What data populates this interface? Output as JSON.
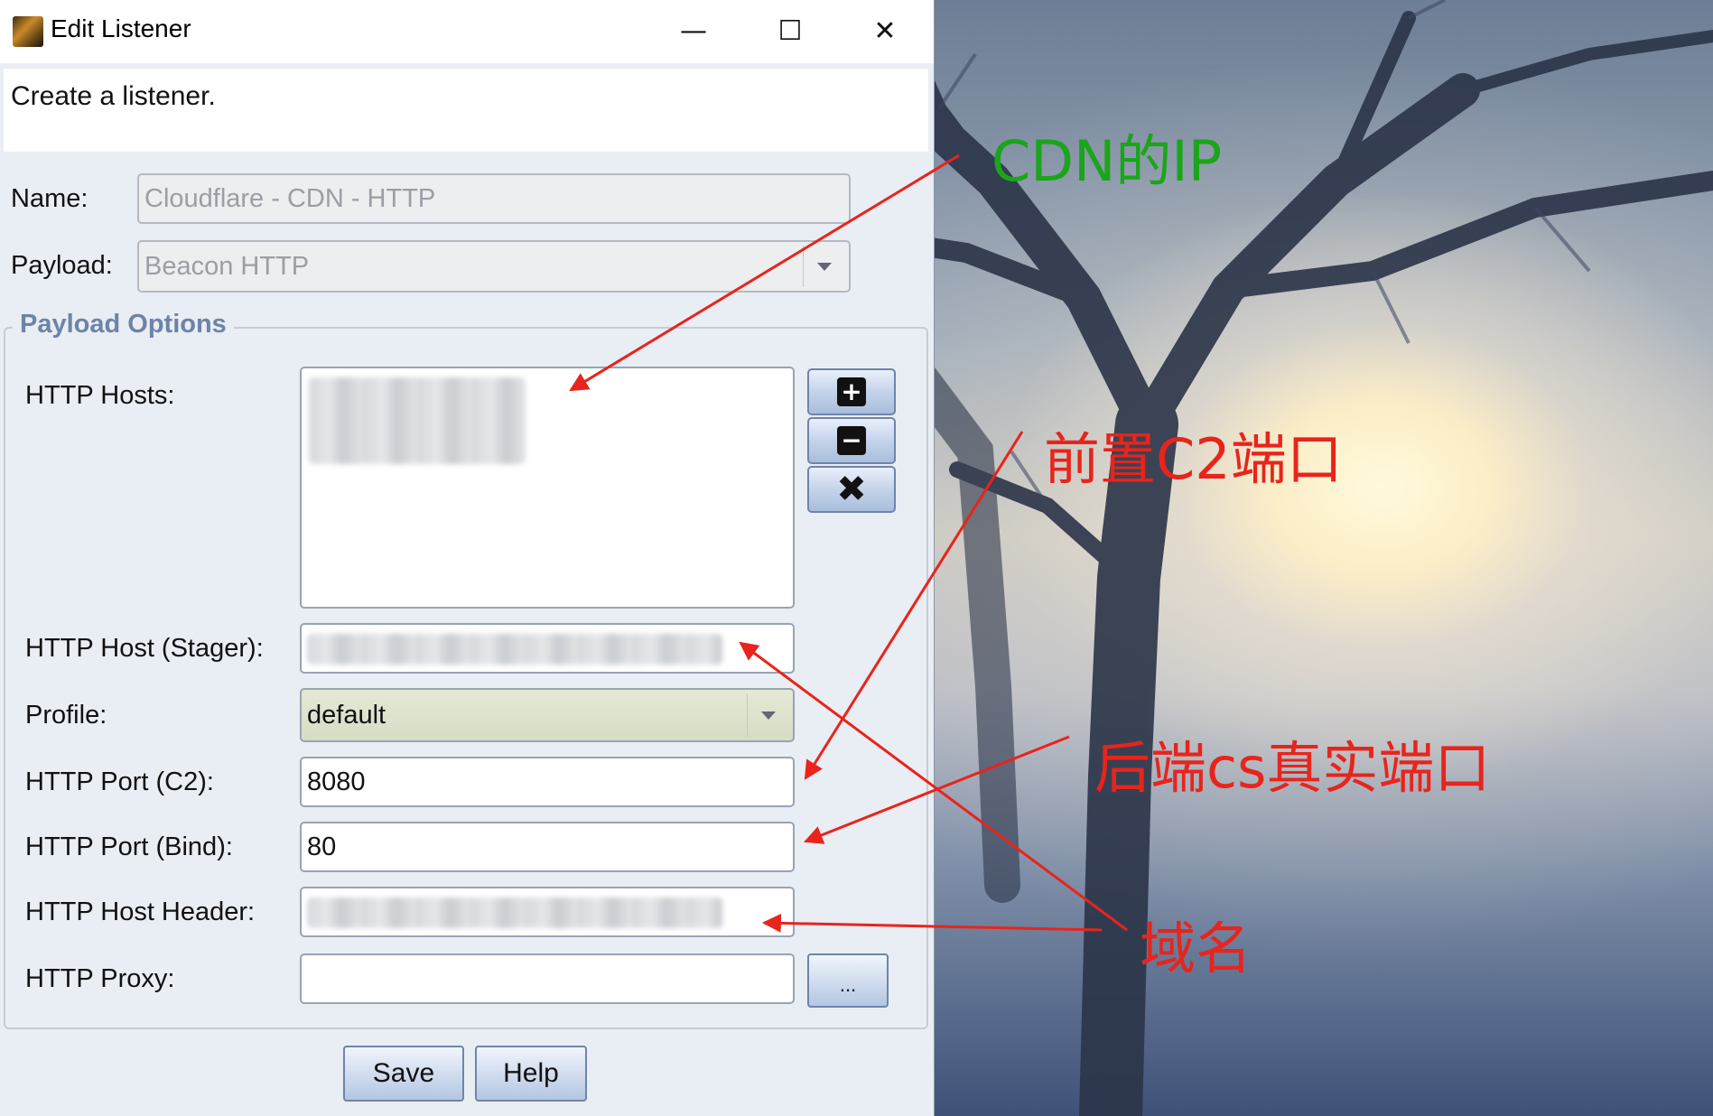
{
  "window": {
    "title": "Edit Listener",
    "controls": {
      "minimize": "—",
      "maximize": "☐",
      "close": "✕"
    }
  },
  "description": "Create a listener.",
  "form": {
    "name": {
      "label": "Name:",
      "value": "Cloudflare - CDN - HTTP"
    },
    "payload": {
      "label": "Payload:",
      "value": "Beacon HTTP"
    }
  },
  "payload_options": {
    "legend": "Payload Options",
    "http_hosts": {
      "label": "HTTP Hosts:"
    },
    "http_host_stager": {
      "label": "HTTP Host (Stager):"
    },
    "profile": {
      "label": "Profile:",
      "value": "default"
    },
    "http_port_c2": {
      "label": "HTTP Port (C2):",
      "value": "8080"
    },
    "http_port_bind": {
      "label": "HTTP Port (Bind):",
      "value": "80"
    },
    "http_host_header": {
      "label": "HTTP Host Header:"
    },
    "http_proxy": {
      "label": "HTTP Proxy:",
      "value": "",
      "browse_label": "..."
    }
  },
  "buttons": {
    "save": "Save",
    "help": "Help"
  },
  "annotations": {
    "cdn_ip": "CDN的IP",
    "front_port": "前置C2端口",
    "backend_port": "后端cs真实端口",
    "domain": "域名",
    "colors": {
      "green": "#1aa51a",
      "red": "#e8241c"
    }
  },
  "icons": [
    "app-icon",
    "plus-icon",
    "minus-icon",
    "remove-icon",
    "chevron-down-icon"
  ]
}
